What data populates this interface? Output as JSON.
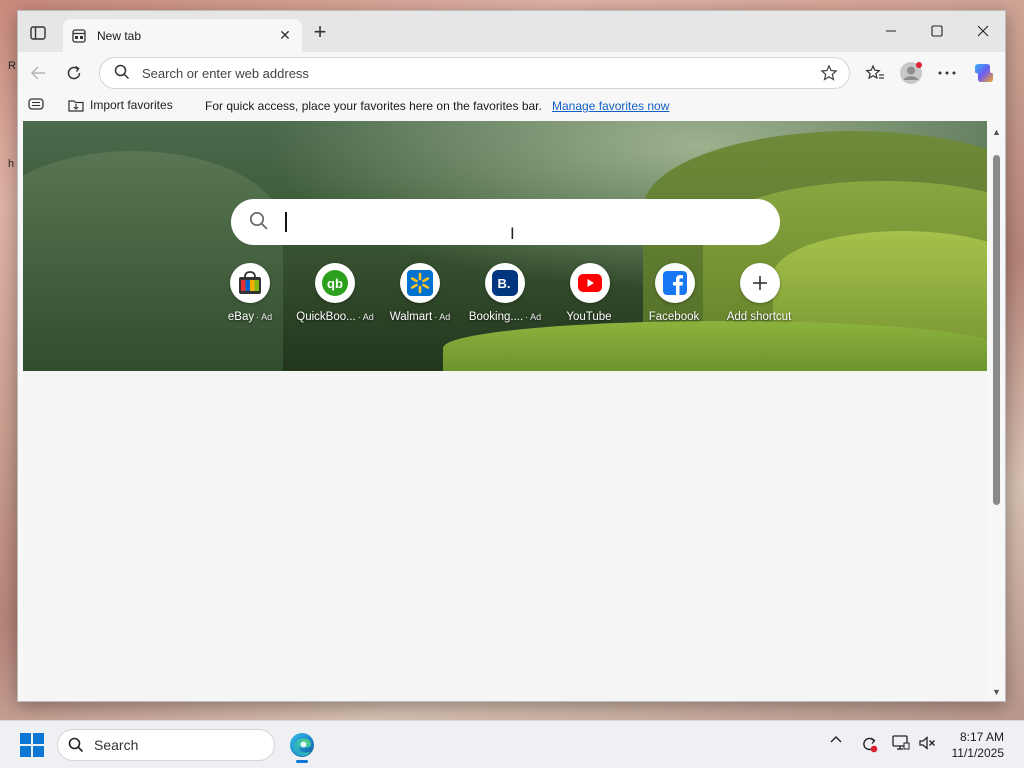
{
  "desktop": {
    "left_text_1": "R",
    "left_text_2": "h"
  },
  "tab": {
    "title": "New tab"
  },
  "address_bar": {
    "placeholder": "Search or enter web address"
  },
  "favorites_bar": {
    "import_label": "Import favorites",
    "hint": "For quick access, place your favorites here on the favorites bar.",
    "manage_link": "Manage favorites now"
  },
  "new_tab_page": {
    "search_value": "",
    "shortcuts": [
      {
        "label": "eBay",
        "ad": "· Ad",
        "icon": "ebay-icon"
      },
      {
        "label": "QuickBoo...",
        "ad": "· Ad",
        "icon": "quickbooks-icon"
      },
      {
        "label": "Walmart",
        "ad": "· Ad",
        "icon": "walmart-icon"
      },
      {
        "label": "Booking....",
        "ad": "· Ad",
        "icon": "booking-icon"
      },
      {
        "label": "YouTube",
        "ad": "",
        "icon": "youtube-icon"
      },
      {
        "label": "Facebook",
        "ad": "",
        "icon": "facebook-icon"
      },
      {
        "label": "Add shortcut",
        "ad": "",
        "icon": "plus-icon"
      }
    ]
  },
  "taskbar": {
    "search_label": "Search",
    "time": "8:17 AM",
    "date": "11/1/2025"
  },
  "colors": {
    "accent": "#0a78d4",
    "link": "#1160c6",
    "youtube": "#ff0000",
    "facebook": "#1877f2",
    "quickbooks": "#2ca01c",
    "walmart": "#0071ce",
    "booking": "#003580"
  }
}
